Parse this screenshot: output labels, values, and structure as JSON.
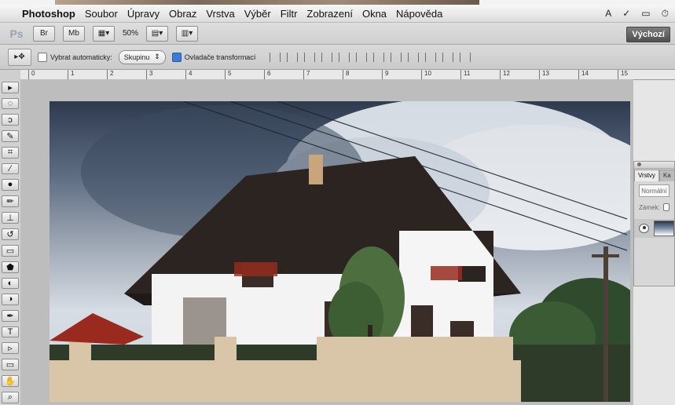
{
  "menubar": {
    "app": "Photoshop",
    "items": [
      "Soubor",
      "Úpravy",
      "Obraz",
      "Vrstva",
      "Výběr",
      "Filtr",
      "Zobrazení",
      "Okna",
      "Nápověda"
    ]
  },
  "appbar": {
    "logo": "Ps",
    "btn_br": "Br",
    "btn_mb": "Mb",
    "zoom": "50%",
    "workspace": "Výchozí"
  },
  "options": {
    "auto_select_label": "Vybrat automaticky:",
    "auto_select_value": "Skupinu",
    "transform_label": "Ovladače transformací"
  },
  "ruler": {
    "labels": [
      "0",
      "1",
      "2",
      "3",
      "4",
      "5",
      "6",
      "7",
      "8",
      "9",
      "10",
      "11",
      "12",
      "13",
      "14",
      "15"
    ]
  },
  "layers_panel": {
    "tabs": [
      "Vrstvy",
      "Ka"
    ],
    "blend_mode": "Normální",
    "lock_label": "Zámek:"
  },
  "icons": {
    "apple": "apple-icon",
    "adobe": "adobe-icon",
    "check": "check-icon",
    "display": "display-icon",
    "clock": "clock-icon"
  }
}
